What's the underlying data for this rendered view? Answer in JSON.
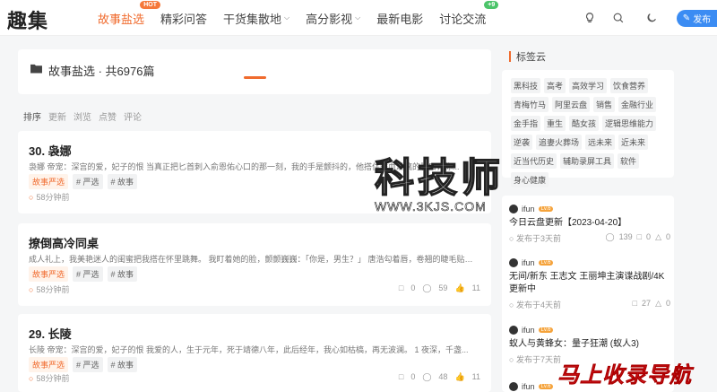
{
  "header": {
    "logo": "趣集",
    "nav": [
      {
        "label": "故事盐选",
        "active": true,
        "badge": "HOT",
        "dropdown": false
      },
      {
        "label": "精彩问答",
        "active": false,
        "badge": "",
        "dropdown": false
      },
      {
        "label": "干货集散地",
        "active": false,
        "badge": "",
        "dropdown": true
      },
      {
        "label": "高分影视",
        "active": false,
        "badge": "",
        "dropdown": true
      },
      {
        "label": "最新电影",
        "active": false,
        "badge": "",
        "dropdown": false
      },
      {
        "label": "讨论交流",
        "active": false,
        "badge": "+9",
        "dropdown": false
      }
    ],
    "publish_label": "发布",
    "icons": [
      "bulb-icon",
      "search-icon",
      "moon-icon",
      "pen-icon"
    ]
  },
  "list_header": {
    "title": "故事盐选 · 共6976篇"
  },
  "sort": {
    "label": "排序",
    "options": [
      "更新",
      "浏览",
      "点赞",
      "评论"
    ]
  },
  "posts": [
    {
      "title": "30. 袅娜",
      "excerpt": "袅娜 帝宠：深宫的爱，妃子的恨 当真正把匕首刺入俞恩佑心口的那一刻，我的手是颤抖的，他搭住鲜血淋漓的胸口，你...",
      "tags": [
        "故事严选",
        "# 严选",
        "# 故事"
      ],
      "time": "58分钟前",
      "comments": "",
      "views": "",
      "likes": ""
    },
    {
      "title": "撩倒高冷同桌",
      "excerpt": "成人礼上，我美艳迷人的闺蜜把我搭在怀里跳舞。 我盯着她的脸，颤颤巍巍：「你是，男生？」 唐浩勾着唇，卷翘的睫毛贴近...",
      "tags": [
        "故事严选",
        "# 严选",
        "# 故事"
      ],
      "time": "58分钟前",
      "comments": "0",
      "views": "59",
      "likes": "11"
    },
    {
      "title": "29. 长陵",
      "excerpt": "长陵 帝宠：深宫的爱，妃子的恨 我爱的人，生于元年，死于靖德八年，此后经年，我心如枯槁，再无波澜。 1 夜深，千盏...",
      "tags": [
        "故事严选",
        "# 严选",
        "# 故事"
      ],
      "time": "58分钟前",
      "comments": "0",
      "views": "48",
      "likes": "11"
    }
  ],
  "sidebar": {
    "tagcloud_title": "标签云",
    "tags": [
      "黑科技",
      "高考",
      "高效学习",
      "饮食营养",
      "青梅竹马",
      "阿里云盘",
      "销售",
      "金融行业",
      "金手指",
      "重生",
      "酷女孩",
      "逻辑思维能力",
      "逆袭",
      "追妻火葬场",
      "远未来",
      "近未来",
      "近当代历史",
      "辅助录屏工具",
      "软件",
      "身心健康"
    ],
    "recent": [
      {
        "user": "ifun",
        "level": "Lv.6",
        "title": "今日云盘更新【2023-04-20】",
        "time": "发布于3天前",
        "views": "139",
        "comments": "0",
        "likes": "0"
      },
      {
        "user": "ifun",
        "level": "Lv.6",
        "title": "无间/新东 王志文 王丽坤主演谍战剧/4K更新中",
        "time": "发布于4天前",
        "views": "",
        "comments": "27",
        "likes": "0"
      },
      {
        "user": "ifun",
        "level": "Lv.6",
        "title": "蚁人与黄蜂女：量子狂潮 (蚁人3)",
        "time": "发布于7天前",
        "views": "",
        "comments": "",
        "likes": ""
      },
      {
        "user": "ifun",
        "level": "Lv.6",
        "title": "",
        "time": "",
        "views": "",
        "comments": "",
        "likes": ""
      }
    ]
  },
  "watermark": {
    "big": "科技师",
    "url": "WWW.3KJS.COM",
    "corner": "马上收录导航"
  },
  "colors": {
    "accent": "#f06b2e",
    "publish": "#3b8cf3"
  }
}
